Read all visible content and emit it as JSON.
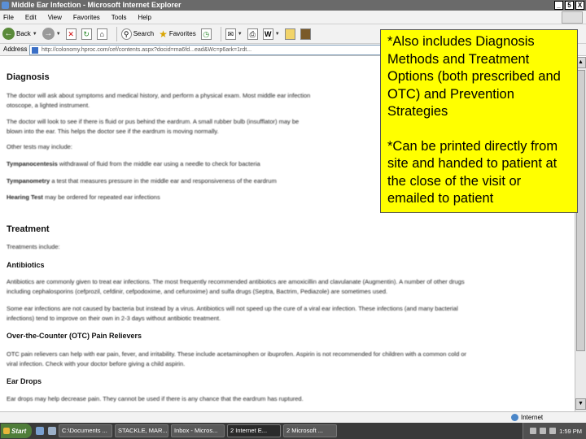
{
  "window": {
    "title": "Middle Ear Infection - Microsoft Internet Explorer",
    "buttons": [
      "_",
      "5",
      "X"
    ]
  },
  "menu": [
    "File",
    "Edit",
    "View",
    "Favorites",
    "Tools",
    "Help"
  ],
  "toolbar": {
    "back_label": "Back",
    "search_label": "Search",
    "favorites_label": "Favorites"
  },
  "address": {
    "label": "Address",
    "url": "http://colonomy.hproc.com/cef/contents.aspx?docid=ma6fd...ead&Wc=p6ark=1rdt..."
  },
  "content": {
    "diagnosis_heading": "Diagnosis",
    "diag_line1": "The doctor will ask about symptoms and medical history, and perform a physical exam. Most middle ear infection",
    "diag_line2": "otoscope, a lighted instrument.",
    "diag_line3": "The doctor will look to see if there is fluid or pus behind the eardrum. A small rubber bulb (insufflator) may be",
    "diag_line4": "blown into the ear. This helps the doctor see if the eardrum is moving normally.",
    "other_tests": "Other tests may include:",
    "tymp_title": "Tympanocentesis",
    "tymp_text": "withdrawal of fluid from the middle ear using a needle to check for bacteria",
    "tympanometry_title": "Tympanometry",
    "tympanometry_text": "a test that measures pressure in the middle ear and responsiveness of the eardrum",
    "hearing_title": "Hearing Test",
    "hearing_text": "may be ordered for repeated ear infections",
    "treatment_heading": "Treatment",
    "treatments_include": "Treatments include:",
    "antibiotics_heading": "Antibiotics",
    "anti_line1": "Antibiotics are commonly given to treat ear infections. The most frequently recommended antibiotics are amoxicillin and clavulanate (Augmentin). A number of other drugs",
    "anti_line2": "including cephalosporins (cefprozil, cefdinir, cefpodoxime, and cefuroxime) and sulfa drugs (Septra, Bactrim, Pediazole) are sometimes used.",
    "anti_line3": "Some ear infections are not caused by bacteria but instead by a virus. Antibiotics will not speed up the cure of a viral ear infection. These infections (and many bacterial",
    "anti_line4": "infections) tend to improve on their own in 2-3 days without antibiotic treatment.",
    "otc_heading": "Over-the-Counter (OTC) Pain Relievers",
    "otc_line1": "OTC pain relievers can help with ear pain, fever, and irritability. These include acetaminophen or ibuprofen. Aspirin is not recommended for children with a common cold or",
    "otc_line2": "viral infection. Check with your doctor before giving a child aspirin.",
    "drops_heading": "Ear Drops",
    "drops_line1": "Ear drops may help decrease pain. They cannot be used if there is any chance that the eardrum has ruptured."
  },
  "status": {
    "zone": "Internet"
  },
  "taskbar": {
    "start_label": "Start",
    "items": [
      "C:\\Documents ...",
      "STACKLE, MAR...",
      "Inbox - Micros...",
      "2 Internet E...",
      "2 Microsoft ..."
    ],
    "clock": "1:59 PM"
  },
  "note": {
    "para1": "*Also includes Diagnosis Methods and Treatment Options (both prescribed and OTC) and Prevention Strategies",
    "para2": "*Can be printed directly from site and handed to patient at the close of the visit or emailed to patient"
  }
}
